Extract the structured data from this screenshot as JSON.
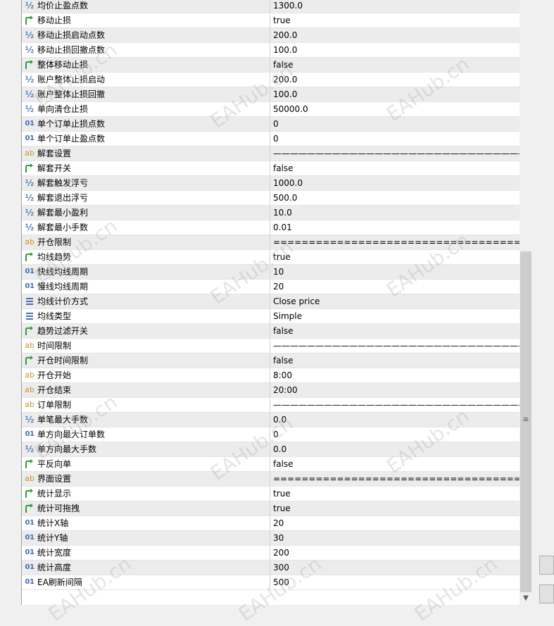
{
  "watermark_text": "EAHub.cn",
  "params": [
    {
      "icon": "half",
      "name": "均价止盈点数",
      "value": "1300.0"
    },
    {
      "icon": "bool",
      "name": "移动止损",
      "value": "true"
    },
    {
      "icon": "half",
      "name": "移动止损启动点数",
      "value": "200.0"
    },
    {
      "icon": "half",
      "name": "移动止损回撤点数",
      "value": "100.0"
    },
    {
      "icon": "bool",
      "name": "整体移动止损",
      "value": "false"
    },
    {
      "icon": "half",
      "name": "账户整体止损启动",
      "value": "200.0"
    },
    {
      "icon": "half",
      "name": "账户整体止损回撤",
      "value": "100.0"
    },
    {
      "icon": "half",
      "name": "单向清仓止损",
      "value": "50000.0"
    },
    {
      "icon": "int",
      "name": "单个订单止损点数",
      "value": "0"
    },
    {
      "icon": "int",
      "name": "单个订单止盈点数",
      "value": "0"
    },
    {
      "icon": "str",
      "name": "解套设置",
      "value": "——————————————————————————————"
    },
    {
      "icon": "bool",
      "name": "解套开关",
      "value": "false"
    },
    {
      "icon": "half",
      "name": "解套触发浮亏",
      "value": "1000.0"
    },
    {
      "icon": "half",
      "name": "解套退出浮亏",
      "value": "500.0"
    },
    {
      "icon": "half",
      "name": "解套最小盈利",
      "value": "10.0"
    },
    {
      "icon": "half",
      "name": "解套最小手数",
      "value": "0.01"
    },
    {
      "icon": "str",
      "name": "开仓限制",
      "value": "===========================================..."
    },
    {
      "icon": "bool",
      "name": "均线趋势",
      "value": "true"
    },
    {
      "icon": "int",
      "name": "快线均线周期",
      "value": "10"
    },
    {
      "icon": "int",
      "name": "慢线均线周期",
      "value": "20"
    },
    {
      "icon": "enum",
      "name": "均线计价方式",
      "value": "Close price"
    },
    {
      "icon": "enum",
      "name": "均线类型",
      "value": "Simple"
    },
    {
      "icon": "bool",
      "name": "趋势过滤开关",
      "value": "false"
    },
    {
      "icon": "str",
      "name": "时间限制",
      "value": "——————————————————————————————"
    },
    {
      "icon": "bool",
      "name": "开仓时间限制",
      "value": "false"
    },
    {
      "icon": "str",
      "name": "开仓开始",
      "value": "8:00"
    },
    {
      "icon": "str",
      "name": "开仓结束",
      "value": "20:00"
    },
    {
      "icon": "str",
      "name": "订单限制",
      "value": "——————————————————————————————"
    },
    {
      "icon": "half",
      "name": "单笔最大手数",
      "value": "0.0"
    },
    {
      "icon": "int",
      "name": "单方向最大订单数",
      "value": "0"
    },
    {
      "icon": "half",
      "name": "单方向最大手数",
      "value": "0.0"
    },
    {
      "icon": "bool",
      "name": "平反向单",
      "value": "false"
    },
    {
      "icon": "str",
      "name": "界面设置",
      "value": "===========================================..."
    },
    {
      "icon": "bool",
      "name": "统计显示",
      "value": "true"
    },
    {
      "icon": "bool",
      "name": "统计可拖拽",
      "value": "true"
    },
    {
      "icon": "int",
      "name": "统计X轴",
      "value": "20"
    },
    {
      "icon": "int",
      "name": "统计Y轴",
      "value": "30"
    },
    {
      "icon": "int",
      "name": "统计宽度",
      "value": "200"
    },
    {
      "icon": "int",
      "name": "统计高度",
      "value": "300"
    },
    {
      "icon": "int",
      "name": "EA刷新间隔",
      "value": "500"
    }
  ],
  "icons": {
    "half": {
      "glyph": "½",
      "name": "double-type-icon"
    },
    "int": {
      "glyph": "01",
      "name": "integer-type-icon"
    },
    "str": {
      "glyph": "ab",
      "name": "string-type-icon"
    },
    "bool": {
      "glyph": "",
      "name": "bool-type-icon"
    },
    "enum": {
      "glyph": "",
      "name": "enum-type-icon"
    }
  },
  "colors": {
    "bool_icon": "#2e9e3c",
    "enum_icon": "#4a6ea8",
    "string_icon": "#d09020",
    "numeric_icon": "#3a6fb0"
  }
}
